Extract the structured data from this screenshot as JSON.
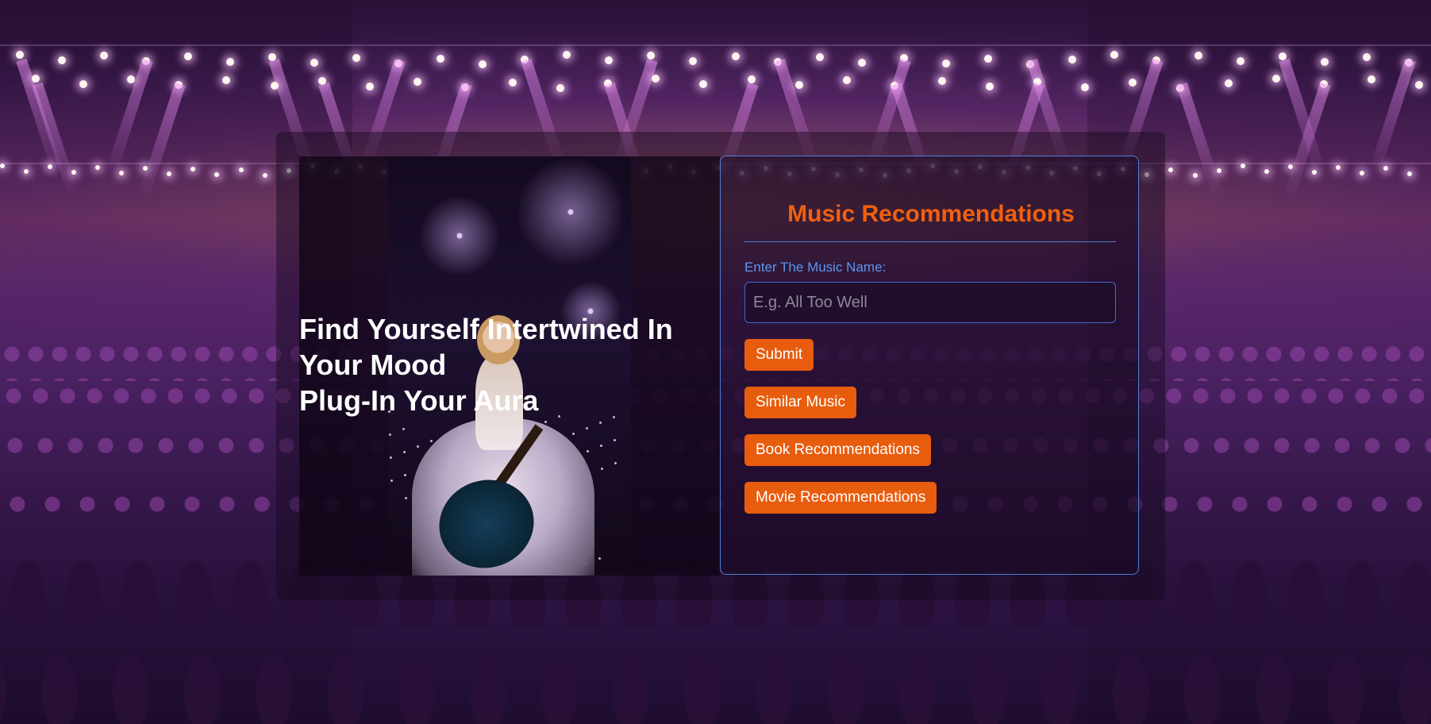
{
  "hero": {
    "line1": "Find Yourself Intertwined In",
    "line2": "Your Mood",
    "line3": "Plug-In Your Aura"
  },
  "form": {
    "title": "Music Recommendations",
    "label": "Enter The Music Name:",
    "placeholder": "E.g. All Too Well",
    "value": ""
  },
  "buttons": {
    "submit": "Submit",
    "similar": "Similar Music",
    "book": "Book Recommendations",
    "movie": "Movie Recommendations"
  },
  "colors": {
    "accent": "#e85c0d",
    "title": "#f0600f",
    "border": "#4f7fd6",
    "label": "#5b97ef"
  }
}
